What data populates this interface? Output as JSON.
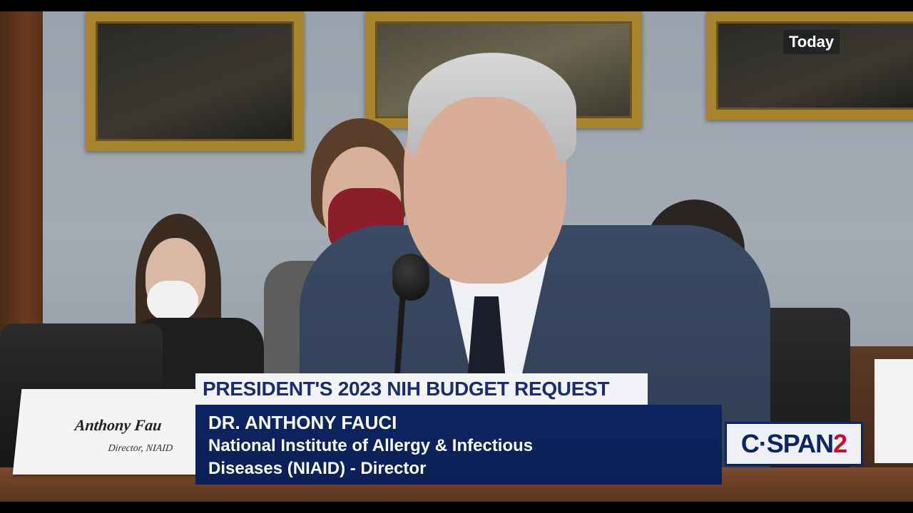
{
  "badge": {
    "label": "Today"
  },
  "nameplate": {
    "name": "Anthony Fau",
    "title": "Director, NIAID"
  },
  "lower_third": {
    "headline": "PRESIDENT'S 2023 NIH BUDGET REQUEST",
    "name": "DR. ANTHONY FAUCI",
    "title_line_1": "National Institute of Allergy & Infectious",
    "title_line_2": "Diseases (NIAID) - Director"
  },
  "logo": {
    "text_main": "C·SPAN",
    "text_accent": "2"
  },
  "colors": {
    "lower_third_navy": "#0d2564",
    "headline_bg": "#f3f4f7",
    "logo_red": "#c8102e",
    "frame_gold": "#a8842e"
  }
}
